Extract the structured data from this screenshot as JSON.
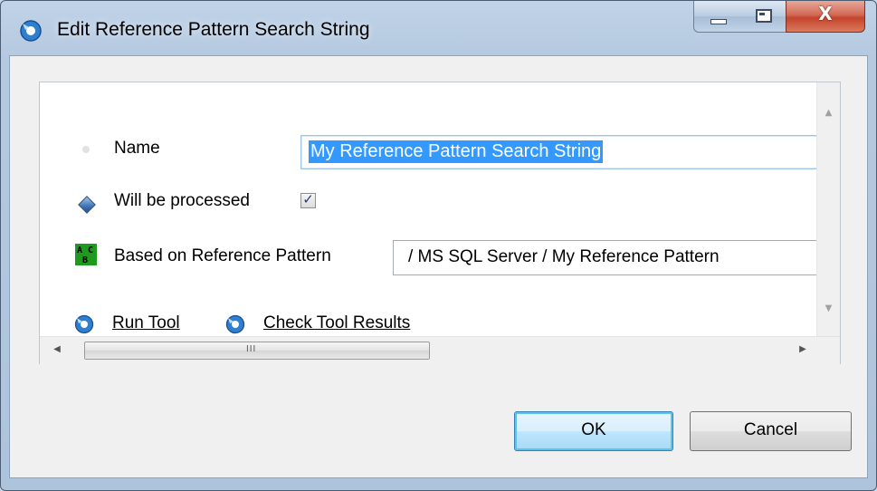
{
  "window": {
    "title": "Edit Reference Pattern Search String",
    "controls": {
      "minimize_icon": "minimize-icon",
      "maximize_icon": "maximize-icon",
      "close_glyph": "X"
    }
  },
  "form": {
    "name": {
      "label": "Name",
      "value": "My Reference Pattern Search String",
      "icon": "bullet-dot-icon"
    },
    "processed": {
      "label": "Will be processed",
      "checked": true,
      "checkmark": "✓",
      "icon": "diamond-icon"
    },
    "reference": {
      "label": "Based on Reference Pattern",
      "value": "/ MS SQL Server / My Reference Pattern",
      "icon": "pattern-abc-icon",
      "icon_text": "A C\n B "
    }
  },
  "links": {
    "run_tool": "Run Tool",
    "check_results": "Check Tool Results"
  },
  "scrollbars": {
    "left": "◀",
    "right": "▶",
    "up": "▲",
    "down": "▼",
    "grip": "III"
  },
  "buttons": {
    "ok": "OK",
    "cancel": "Cancel"
  },
  "colors": {
    "selection": "#3399ff",
    "ok_border": "#3c7fb1",
    "link_icon": "#2f7fd1"
  }
}
